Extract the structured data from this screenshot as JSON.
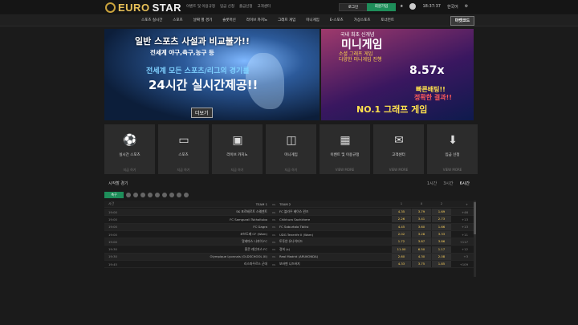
{
  "brand": {
    "word1": "EURO",
    "word2": "STAR",
    "accent": "#c9a23c"
  },
  "top_links": [
    "이벤트 및 이용규정",
    "입금 신청",
    "출금신청",
    "고객센터"
  ],
  "auth": {
    "login": "로그인",
    "join": "회원가입"
  },
  "top_right": {
    "time": "18:37:37",
    "lang": "한국어"
  },
  "nav": {
    "items": [
      "스포츠 실시간",
      "스포츠",
      "날짜 별 경기",
      "슬롯머신",
      "라이브 카지노",
      "그래프 게임",
      "미니게임",
      "E-스포츠",
      "가상스포츠",
      "토너먼트"
    ],
    "button": "마켓코드"
  },
  "banner_left": {
    "title": "일반 스포츠 사설과 비교불가!!",
    "sub": "전세계 야구,축구,농구 등",
    "line3": "전세계 모든 스포츠/리그의 경기를",
    "line4": "24시간 실시간제공!!",
    "more": "더보기"
  },
  "banner_right": {
    "top": "국내 최초 신개념",
    "title": "미니게임",
    "desc": "소셜 그래프 게임",
    "line2": "다양한 미니게임 진행",
    "multiplier": "8.57x",
    "fast": "빠른배팅!!",
    "result": "정확한 결과!!",
    "slogan": "NO.1 그래프 게임"
  },
  "cards": [
    {
      "label": "실시간 스포츠",
      "sub": "지금 하기",
      "icon": "soccer-ball-icon"
    },
    {
      "label": "스포츠",
      "sub": "지금 하기",
      "icon": "tablet-icon"
    },
    {
      "label": "라이브 카지노",
      "sub": "지금 하기",
      "icon": "monitor-icon"
    },
    {
      "label": "미니게임",
      "sub": "지금 하기",
      "icon": "chat-icon"
    },
    {
      "label": "이벤트 및 이용규정",
      "sub": "VIEW MORE",
      "icon": "calendar-icon"
    },
    {
      "label": "고객센터",
      "sub": "VIEW MORE",
      "icon": "mail-icon"
    },
    {
      "label": "입금 신청",
      "sub": "VIEW MORE",
      "icon": "download-icon"
    }
  ],
  "matches": {
    "title": "시작할 경기",
    "tabs": [
      "1시간",
      "3시간",
      "6시간"
    ],
    "filter_label": "축구",
    "columns": {
      "time": "시간",
      "team1": "TEAM 1",
      "team2": "TEAM 2",
      "o1": "1",
      "ox": "X",
      "o2": "2",
      "more": "+"
    },
    "rows": [
      {
        "time": "19:00",
        "home": "SK 포르베르트 스웨덴트",
        "away": "FC 블라우 베이스 윈즈",
        "o1": "4.35",
        "ox": "3.79",
        "o2": "1.69",
        "more": "+46"
      },
      {
        "time": "19:00",
        "home": "FC Samgurali Tskhaltubo",
        "away": "Chikhura Sachkhere",
        "o1": "2.26",
        "ox": "3.41",
        "o2": "2.73",
        "more": "+13"
      },
      {
        "time": "19:00",
        "home": "FC Gagra",
        "away": "FC Saburtalo Tbilisi",
        "o1": "4.45",
        "ox": "3.60",
        "o2": "1.66",
        "more": "+13"
      },
      {
        "time": "19:00",
        "home": "코브도베 CF (Wom)",
        "away": "UDG Tenerife II (Wom)",
        "o1": "2.02",
        "ox": "3.28",
        "o2": "3.33",
        "more": "+11"
      },
      {
        "time": "19:00",
        "home": "알레마스 나지아 FC",
        "away": "토투얀 유나이티드",
        "o1": "1.72",
        "ox": "3.87",
        "o2": "3.86",
        "more": "+117"
      },
      {
        "time": "19:30",
        "home": "홍콘 레인저스 FC",
        "away": "정희 (s)",
        "o1": "11.00",
        "ox": "6.50",
        "o2": "1.17",
        "more": "+12"
      },
      {
        "time": "19:30",
        "home": "Olympique Lyonnais (OLDSCHOOL XI)",
        "away": "Real Madrid (ARUKONDA)",
        "o1": "2.60",
        "ox": "4.30",
        "o2": "2.08",
        "more": "+3"
      },
      {
        "time": "19:45",
        "home": "리스파우르스 군데",
        "away": "보바멘 니즈바지",
        "o1": "4.33",
        "ox": "3.75",
        "o2": "1.85",
        "more": "+109"
      }
    ]
  }
}
